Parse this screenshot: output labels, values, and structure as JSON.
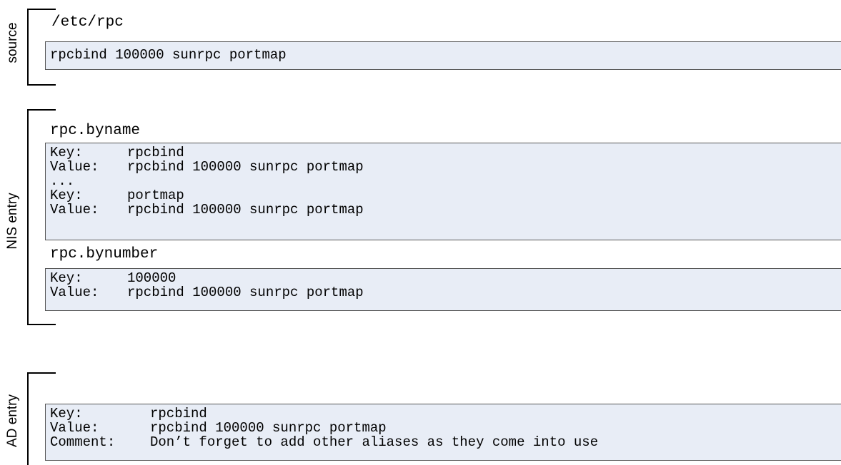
{
  "sections": {
    "source": {
      "label": "source",
      "title": "/etc/rpc",
      "lines": [
        "rpcbind 100000 sunrpc portmap"
      ]
    },
    "nis": {
      "label": "NIS entry",
      "byname_title": "rpc.byname",
      "byname_lines": [
        {
          "key": "Key:",
          "value": "rpcbind"
        },
        {
          "key": "Value:",
          "value": "rpcbind 100000 sunrpc portmap"
        },
        {
          "key": "...",
          "value": ""
        },
        {
          "key": "Key:",
          "value": "portmap"
        },
        {
          "key": "Value:",
          "value": "rpcbind 100000 sunrpc portmap"
        }
      ],
      "bynumber_title": "rpc.bynumber",
      "bynumber_lines": [
        {
          "key": "Key:",
          "value": "100000"
        },
        {
          "key": "Value:",
          "value": "rpcbind 100000 sunrpc portmap"
        }
      ]
    },
    "ad": {
      "label": "AD entry",
      "lines": [
        {
          "key": "Key:",
          "value": "rpcbind"
        },
        {
          "key": "Value:",
          "value": "rpcbind 100000 sunrpc portmap"
        },
        {
          "key": "Comment:",
          "value": "Don’t forget to add other aliases as they come into use"
        }
      ]
    }
  }
}
